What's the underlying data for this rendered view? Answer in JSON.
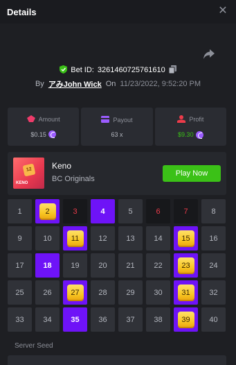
{
  "header": {
    "title": "Details",
    "close_icon": "close-icon"
  },
  "bet": {
    "id_label": "Bet ID:",
    "id_value": "3261460725761610",
    "by_label": "By",
    "username": "アみJohn Wick",
    "on_label": "On",
    "datetime": "11/23/2022, 9:52:20 PM"
  },
  "stats": {
    "amount": {
      "label": "Amount",
      "value": "$0.15"
    },
    "payout": {
      "label": "Payout",
      "value": "63 x"
    },
    "profit": {
      "label": "Profit",
      "value": "$9.30"
    }
  },
  "game": {
    "name": "Keno",
    "provider": "BC Originals",
    "play_label": "Play Now",
    "thumb_tile": "12",
    "thumb_label": "KENO"
  },
  "grid": [
    {
      "n": "1",
      "state": "normal"
    },
    {
      "n": "2",
      "state": "hit"
    },
    {
      "n": "3",
      "state": "drawn"
    },
    {
      "n": "4",
      "state": "picked"
    },
    {
      "n": "5",
      "state": "normal"
    },
    {
      "n": "6",
      "state": "drawn"
    },
    {
      "n": "7",
      "state": "drawn"
    },
    {
      "n": "8",
      "state": "normal"
    },
    {
      "n": "9",
      "state": "normal"
    },
    {
      "n": "10",
      "state": "normal"
    },
    {
      "n": "11",
      "state": "hit"
    },
    {
      "n": "12",
      "state": "normal"
    },
    {
      "n": "13",
      "state": "normal"
    },
    {
      "n": "14",
      "state": "normal"
    },
    {
      "n": "15",
      "state": "hit"
    },
    {
      "n": "16",
      "state": "normal"
    },
    {
      "n": "17",
      "state": "normal"
    },
    {
      "n": "18",
      "state": "picked"
    },
    {
      "n": "19",
      "state": "normal"
    },
    {
      "n": "20",
      "state": "normal"
    },
    {
      "n": "21",
      "state": "normal"
    },
    {
      "n": "22",
      "state": "normal"
    },
    {
      "n": "23",
      "state": "hit"
    },
    {
      "n": "24",
      "state": "normal"
    },
    {
      "n": "25",
      "state": "normal"
    },
    {
      "n": "26",
      "state": "normal"
    },
    {
      "n": "27",
      "state": "hit"
    },
    {
      "n": "28",
      "state": "normal"
    },
    {
      "n": "29",
      "state": "normal"
    },
    {
      "n": "30",
      "state": "normal"
    },
    {
      "n": "31",
      "state": "hit"
    },
    {
      "n": "32",
      "state": "normal"
    },
    {
      "n": "33",
      "state": "normal"
    },
    {
      "n": "34",
      "state": "normal"
    },
    {
      "n": "35",
      "state": "picked"
    },
    {
      "n": "36",
      "state": "normal"
    },
    {
      "n": "37",
      "state": "normal"
    },
    {
      "n": "38",
      "state": "normal"
    },
    {
      "n": "39",
      "state": "hit"
    },
    {
      "n": "40",
      "state": "normal"
    }
  ],
  "seed": {
    "label": "Server Seed"
  },
  "colors": {
    "background": "#1e1f23",
    "accent_green": "#3bc117",
    "picked_purple": "#6e13f7",
    "drawn_red": "#ed3b4a",
    "tile_gold": "#f8c623"
  }
}
